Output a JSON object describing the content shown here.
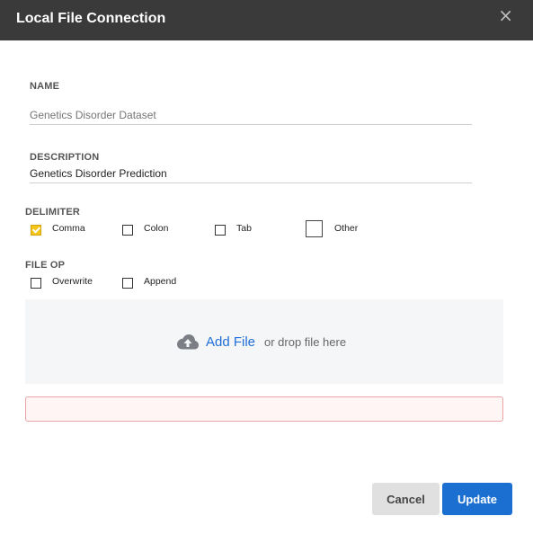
{
  "dialog": {
    "title": "Local File Connection",
    "close_icon": "×"
  },
  "name": {
    "label": "NAME",
    "placeholder": "Genetics Disorder Dataset",
    "value": ""
  },
  "description": {
    "label": "DESCRIPTION",
    "value": "Genetics Disorder Prediction"
  },
  "delimiter": {
    "label": "DELIMITER",
    "options": [
      {
        "label": "Comma",
        "checked": true
      },
      {
        "label": "Colon",
        "checked": false
      },
      {
        "label": "Tab",
        "checked": false
      },
      {
        "label": "Other",
        "checked": false
      }
    ]
  },
  "file_op": {
    "label": "FILE OP",
    "options": [
      {
        "label": "Overwrite",
        "checked": false
      },
      {
        "label": "Append",
        "checked": false
      }
    ]
  },
  "dropzone": {
    "add_file_label": "Add File",
    "drop_text": "or drop file here",
    "icon": "cloud-upload-icon"
  },
  "error": {
    "message": ""
  },
  "footer": {
    "cancel_label": "Cancel",
    "update_label": "Update"
  },
  "colors": {
    "header_bg": "#3a3a3a",
    "primary": "#1a6fd1",
    "checked": "#f5c518",
    "error_border": "#e9a5a5"
  }
}
